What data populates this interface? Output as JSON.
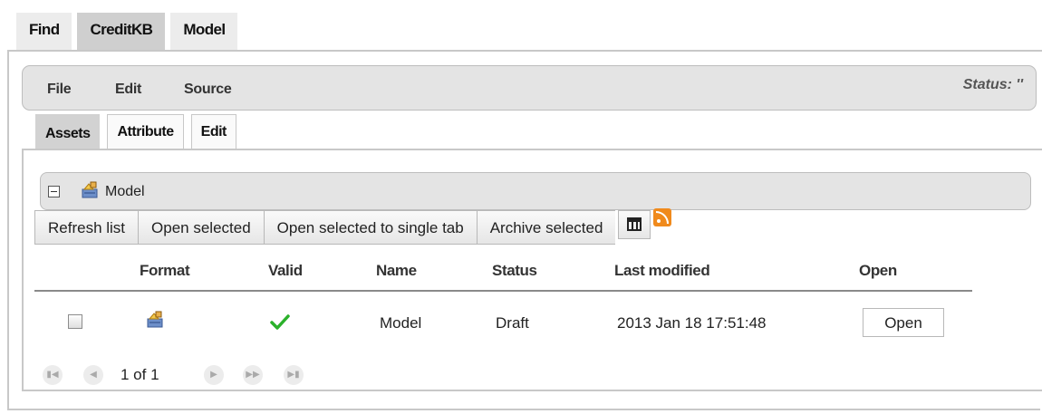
{
  "top_tabs": [
    {
      "label": "Find",
      "active": false
    },
    {
      "label": "CreditKB",
      "active": true
    },
    {
      "label": "Model",
      "active": false
    }
  ],
  "menubar": {
    "items": [
      "File",
      "Edit",
      "Source"
    ],
    "status": "Status: ''"
  },
  "sub_tabs": [
    {
      "label": "Assets",
      "active": true
    },
    {
      "label": "Attribute",
      "active": false
    },
    {
      "label": "Edit",
      "active": false
    }
  ],
  "section": {
    "title": "Model",
    "collapse_icon": "collapse-minus-icon",
    "icon": "package-icon"
  },
  "toolbar": {
    "refresh": "Refresh list",
    "open_selected": "Open selected",
    "open_single": "Open selected to single tab",
    "archive": "Archive selected",
    "columns_icon": "columns-icon",
    "rss_icon": "rss-feed-icon"
  },
  "table": {
    "headers": [
      "Format",
      "Valid",
      "Name",
      "Status",
      "Last modified",
      "Open"
    ],
    "rows": [
      {
        "checked": false,
        "format_icon": "package-icon",
        "valid": true,
        "name": "Model",
        "status": "Draft",
        "last_modified": "2013 Jan 18 17:51:48",
        "open_label": "Open"
      }
    ]
  },
  "pager": {
    "text": "1 of 1",
    "buttons": [
      "first-page-icon",
      "prev-page-icon",
      "next-page-icon",
      "fast-forward-icon",
      "last-page-icon"
    ]
  },
  "colors": {
    "accent_check": "#2bb12b",
    "rss": "#f08a1c",
    "panel_bg": "#e4e4e4"
  }
}
